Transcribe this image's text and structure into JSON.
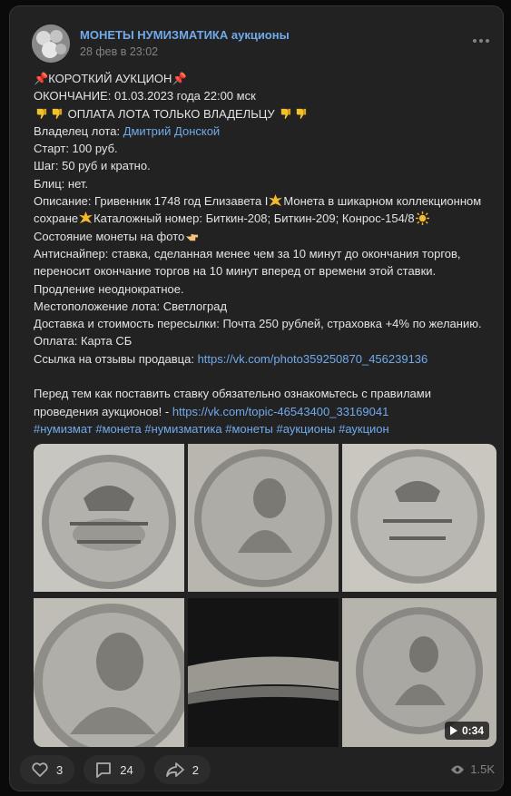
{
  "post": {
    "author": "МОНЕТЫ НУМИЗМАТИКА аукционы",
    "date": "28 фев в 23:02",
    "lines": {
      "l1": "КОРОТКИЙ АУКЦИОН",
      "l2": "ОКОНЧАНИЕ: 01.03.2023 года 22:00 мск",
      "l3": "ОПЛАТА ЛОТА ТОЛЬКО ВЛАДЕЛЬЦУ",
      "l4_prefix": "Владелец лота: ",
      "l4_link": "Дмитрий Донской",
      "l5": "Старт: 100 руб.",
      "l6": "Шаг: 50 руб и кратно.",
      "l7": "Блиц: нет.",
      "l8_a": "Описание: Гривенник 1748 год Елизавета I",
      "l8_b": "Монета в шикарном коллекционном",
      "l9_a": "сохране",
      "l9_b": "Каталожный номер: Биткин-208; Биткин-209; Конрос-154/8",
      "l10": "Состояние монеты на фото",
      "l11": "Антиснайпер: ставка, сделанная менее чем за 10 минут до окончания торгов,",
      "l12": "переносит окончание торгов на 10 минут вперед от времени этой ставки.",
      "l13": "Продление неоднократное.",
      "l14": "Местоположение лота: Светлоград",
      "l15": "Доставка и стоимость пересылки: Почта 250 рублей, страховка +4% по желанию.",
      "l16": "Оплата: Карта СБ",
      "l17_prefix": "Ссылка на отзывы продавца: ",
      "l17_link": "https://vk.com/photo359250870_456239136",
      "l19": "Перед тем как поставить ставку обязательно ознакомьтесь с правилами",
      "l20_prefix": "проведения аукционов! - ",
      "l20_link": "https://vk.com/topic-46543400_33169041",
      "hashtags": "#нумизмат #монета #нумизматика #монеты #аукционы #аукцион"
    },
    "video_duration": "0:34",
    "likes": "3",
    "comments": "24",
    "shares": "2",
    "views": "1.5K",
    "colors": {
      "link": "#71aaeb",
      "background": "#222222",
      "secondary": "#828282"
    },
    "icons": [
      "pin-icon",
      "thumbs-down-icon",
      "star-icon",
      "pointing-hand-icon",
      "sun-icon",
      "heart-icon",
      "comment-icon",
      "share-icon",
      "eye-icon",
      "more-icon",
      "play-icon"
    ]
  }
}
